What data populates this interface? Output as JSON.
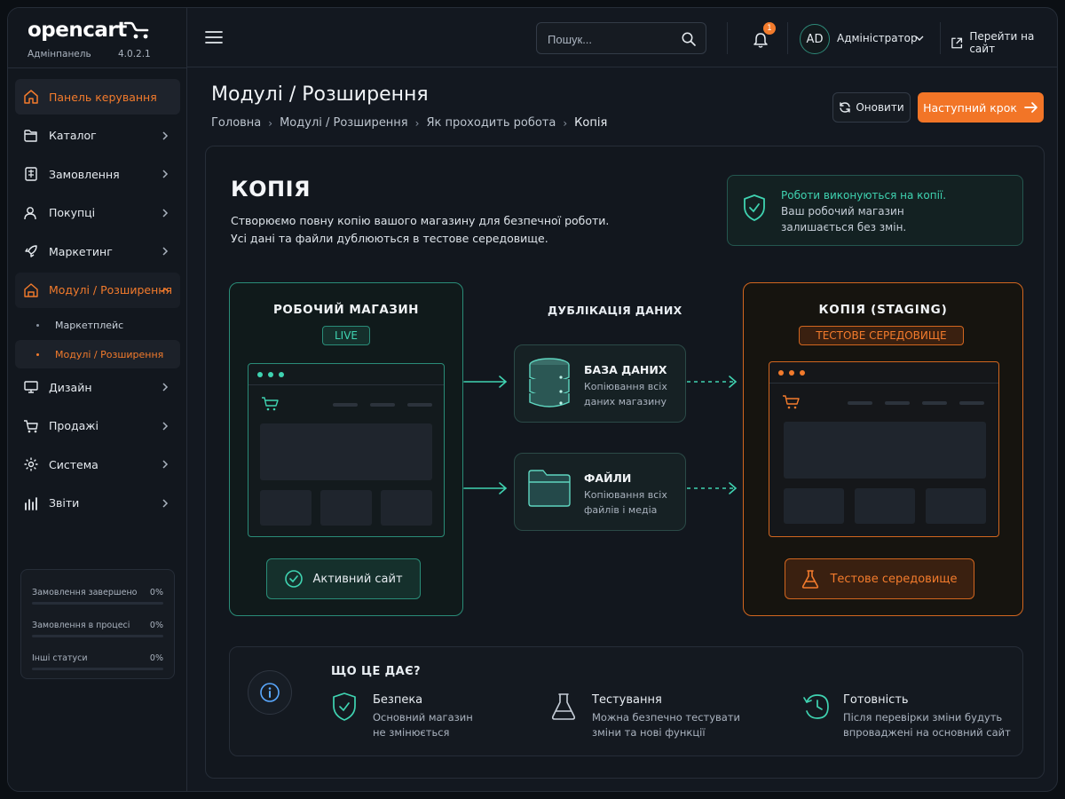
{
  "brand": {
    "logo": "opencart",
    "subtitle": "Адмінпанель",
    "version": "4.0.2.1",
    "accent": "#f37b2c",
    "teal": "#3fd3b1"
  },
  "sidebar": {
    "items": [
      {
        "label": "Панель керування",
        "icon": "home-icon"
      },
      {
        "label": "Каталог",
        "icon": "tag-icon"
      },
      {
        "label": "Замовлення",
        "icon": "receipt-icon"
      },
      {
        "label": "Покупці",
        "icon": "user-icon"
      },
      {
        "label": "Маркетинг",
        "icon": "rocket-icon"
      },
      {
        "label": "Модулі / Розширення",
        "icon": "puzzle-icon"
      },
      {
        "label": "Дизайн",
        "icon": "monitor-icon"
      },
      {
        "label": "Продажі",
        "icon": "cart-icon"
      },
      {
        "label": "Система",
        "icon": "gear-icon"
      },
      {
        "label": "Звіти",
        "icon": "bar-chart-icon"
      }
    ],
    "sub_items": [
      {
        "label": "Маркетплейс"
      },
      {
        "label": "Модулі / Розширення"
      }
    ],
    "stats": [
      {
        "label": "Замовлення завершено",
        "value": "0%",
        "progress": 0
      },
      {
        "label": "Замовлення в процесі",
        "value": "0%",
        "progress": 0
      },
      {
        "label": "Інші статуси",
        "value": "0%",
        "progress": 0
      }
    ]
  },
  "topbar": {
    "search_placeholder": "Пошук...",
    "notifications": "1",
    "avatar": "AD",
    "user": "Адміністратор",
    "goto_site": "Перейти на сайт"
  },
  "page": {
    "title": "Модулі / Розширення",
    "breadcrumbs": [
      "Головна",
      "Модулі / Розширення",
      "Як проходить робота",
      "Копія"
    ],
    "refresh": "Оновити",
    "next": "Наступний крок"
  },
  "content": {
    "heading": "КОПІЯ",
    "desc1": "Створюємо  повну копію вашого магазину для безпечної роботи.",
    "desc2": "Усі дані та файли дублюються в тестове середовище.",
    "info": {
      "line1": "Роботи виконуються на копії.",
      "line2": "Ваш робочий магазин",
      "line3": "залишається без змін."
    },
    "live": {
      "title": "РОБОЧИЙ МАГАЗИН",
      "badge": "LIVE",
      "button": "Активний сайт"
    },
    "middle": {
      "title": "ДУБЛІКАЦІЯ ДАНИХ",
      "db": {
        "title": "БАЗА ДАНИХ",
        "line1": "Копіювання всіх",
        "line2": "даних магазину"
      },
      "files": {
        "title": "ФАЙЛИ",
        "line1": "Копіювання всіх",
        "line2": "файлів і медіа"
      }
    },
    "staging": {
      "title": "КОПІЯ  (STAGING)",
      "badge": "ТЕСТОВЕ СЕРЕДОВИЩЕ",
      "button": "Тестове середовище"
    },
    "benefits": {
      "title": "ЩО ЦЕ ДАЄ?",
      "items": [
        {
          "title": "Безпека",
          "line1": "Основний магазин",
          "line2": "не змінюється"
        },
        {
          "title": "Тестування",
          "line1": "Можна безпечно тестувати",
          "line2": "зміни та нові функції"
        },
        {
          "title": "Готовність",
          "line1": "Після перевірки зміни будуть",
          "line2": "впроваджені на основний сайт"
        }
      ]
    }
  }
}
